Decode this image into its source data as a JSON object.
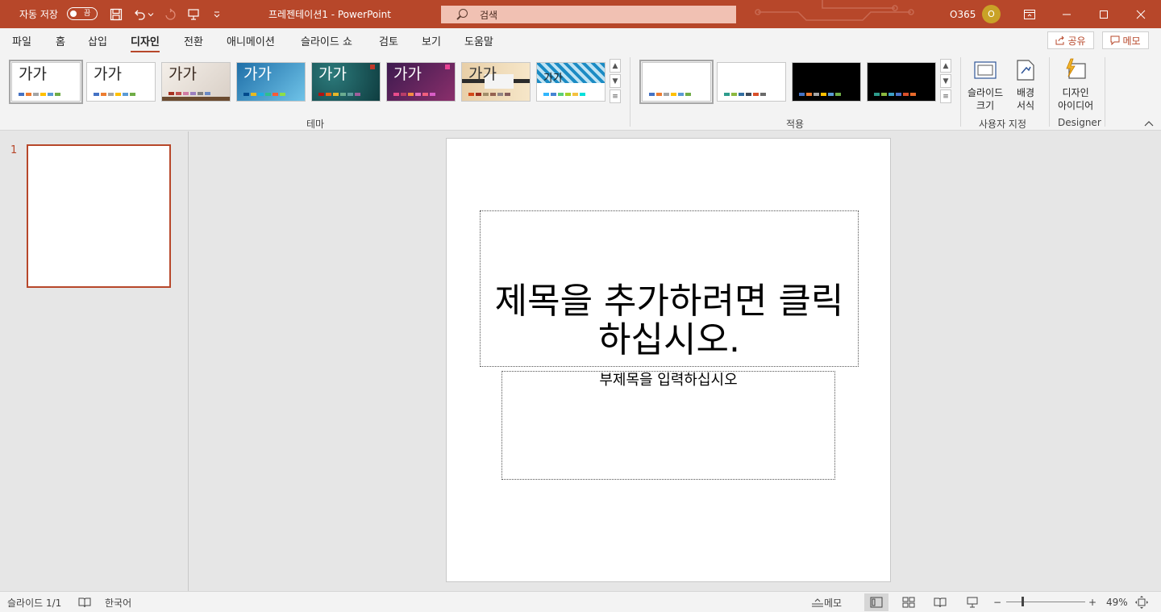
{
  "titlebar": {
    "autosave_label": "자동 저장",
    "autosave_state": "끔",
    "doc_title": "프레젠테이션1  -  PowerPoint",
    "search_placeholder": "검색",
    "account_name": "O365",
    "avatar_initial": "O"
  },
  "tabs": [
    "파일",
    "홈",
    "삽입",
    "디자인",
    "전환",
    "애니메이션",
    "슬라이드 쇼",
    "검토",
    "보기",
    "도움말"
  ],
  "active_tab": "디자인",
  "share_label": "공유",
  "memo_label": "메모",
  "ribbon": {
    "theme_sample_text": "가가",
    "themes_group_label": "테마",
    "variants_group_label": "적용",
    "customize_group_label": "사용자 지정",
    "designer_group_label": "Designer",
    "slide_size_label": "슬라이드\n크기",
    "format_background_label": "배경\n서식",
    "design_ideas_label": "디자인\n아이디어"
  },
  "slides_pane": {
    "slide_number": "1"
  },
  "slide": {
    "title_placeholder": "제목을 추가하려면 클릭하십시오.",
    "subtitle_placeholder": "부제목을 입력하십시오"
  },
  "statusbar": {
    "slide_counter": "슬라이드 1/1",
    "language": "한국어",
    "notes_label": "메모",
    "zoom_level": "49%"
  },
  "colors": {
    "accent": "#b7472a",
    "ribbon_bg": "#f3f3f3",
    "canvas_bg": "#e6e6e6"
  }
}
